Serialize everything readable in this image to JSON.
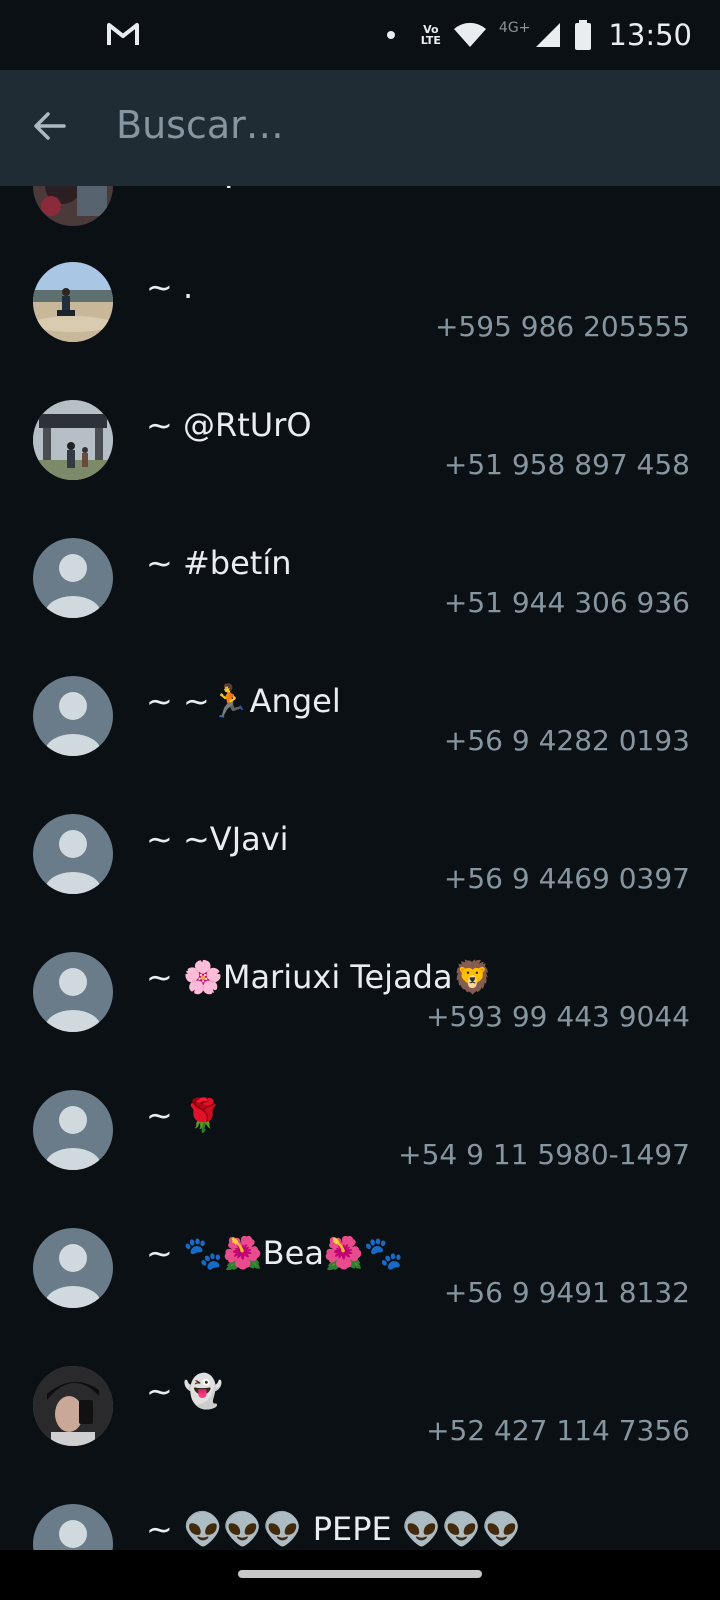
{
  "status_bar": {
    "time": "13:50",
    "network_badge": "4G+",
    "volte_top": "Vo",
    "volte_bottom": "LTE",
    "icons": [
      "gmail-icon",
      "notification-dot-icon",
      "volte-icon",
      "wifi-icon",
      "signal-icon",
      "battery-icon"
    ]
  },
  "header": {
    "back_icon": "arrow-left-icon",
    "search_placeholder": "Buscar…"
  },
  "colors": {
    "background": "#0b1014",
    "header": "#1f2c34",
    "primary_text": "#e9edef",
    "secondary_text": "#8696a0",
    "default_avatar": "#6a7c89"
  },
  "contacts": [
    {
      "name": "~ .",
      "phone": "+595 986 205555",
      "avatar": "photo-beach"
    },
    {
      "name": "~ @RtUrO",
      "phone": "+51 958 897 458",
      "avatar": "photo-barcelona"
    },
    {
      "name": "~ #betín",
      "phone": "+51 944 306 936",
      "avatar": "default"
    },
    {
      "name": "~ ~🏃Angel",
      "phone": "+56 9 4282 0193",
      "avatar": "default"
    },
    {
      "name": "~ ~VJavi",
      "phone": "+56 9 4469 0397",
      "avatar": "default"
    },
    {
      "name": "~ 🌸Mariuxi Tejada🦁",
      "phone": "+593 99 443 9044",
      "avatar": "default"
    },
    {
      "name": "~ 🌹",
      "phone": "+54 9 11 5980-1497",
      "avatar": "default"
    },
    {
      "name": "~ 🐾🌺Bea🌺🐾",
      "phone": "+56 9 9491 8132",
      "avatar": "default"
    },
    {
      "name": "~ 👻",
      "phone": "+52 427 114 7356",
      "avatar": "photo-selfie"
    },
    {
      "name": "~ 👽👽👽 PEPE 👽👽👽",
      "phone": "",
      "avatar": "default"
    }
  ]
}
